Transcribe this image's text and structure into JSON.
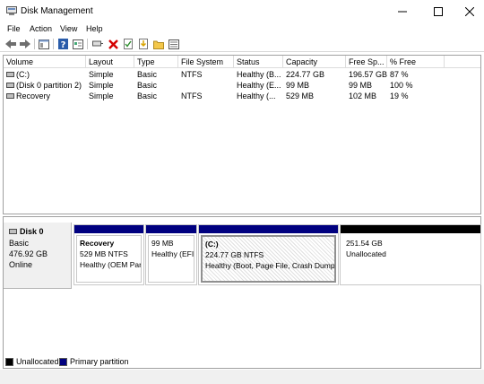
{
  "window": {
    "title": "Disk Management",
    "app_icon": "disk-management-icon",
    "controls": [
      "minimize-icon",
      "maximize-icon",
      "close-icon"
    ]
  },
  "menu": [
    "File",
    "Action",
    "View",
    "Help"
  ],
  "toolbar_icons": [
    "back-arrow-icon",
    "forward-arrow-icon",
    "console-tree-icon",
    "help-icon",
    "properties-icon",
    "connect-icon",
    "delete-icon",
    "check-icon",
    "import-icon",
    "folder-icon",
    "show-hide-icon"
  ],
  "volume_list": {
    "columns": [
      "Volume",
      "Layout",
      "Type",
      "File System",
      "Status",
      "Capacity",
      "Free Sp...",
      "% Free"
    ],
    "rows": [
      [
        "(C:)",
        "Simple",
        "Basic",
        "NTFS",
        "Healthy (B...",
        "224.77 GB",
        "196.57 GB",
        "87 %"
      ],
      [
        "(Disk 0 partition 2)",
        "Simple",
        "Basic",
        "",
        "Healthy (E...",
        "99 MB",
        "99 MB",
        "100 %"
      ],
      [
        "Recovery",
        "Simple",
        "Basic",
        "NTFS",
        "Healthy (...",
        "529 MB",
        "102 MB",
        "19 %"
      ]
    ]
  },
  "disk": {
    "name": "Disk 0",
    "type": "Basic",
    "size": "476.92 GB",
    "status": "Online",
    "partitions": [
      {
        "name": "Recovery",
        "size_fs": "529 MB NTFS",
        "status": "Healthy (OEM Par"
      },
      {
        "name": "",
        "size_fs": "99 MB",
        "status": "Healthy (EFI"
      },
      {
        "name": "(C:)",
        "size_fs": "224.77 GB NTFS",
        "status": "Healthy (Boot, Page File, Crash Dump,"
      },
      {
        "name": "",
        "size_fs": "251.54 GB",
        "status": "Unallocated"
      }
    ]
  },
  "legend": [
    {
      "label": "Unallocated",
      "color": "#000000"
    },
    {
      "label": "Primary partition",
      "color": "#00007f"
    }
  ]
}
